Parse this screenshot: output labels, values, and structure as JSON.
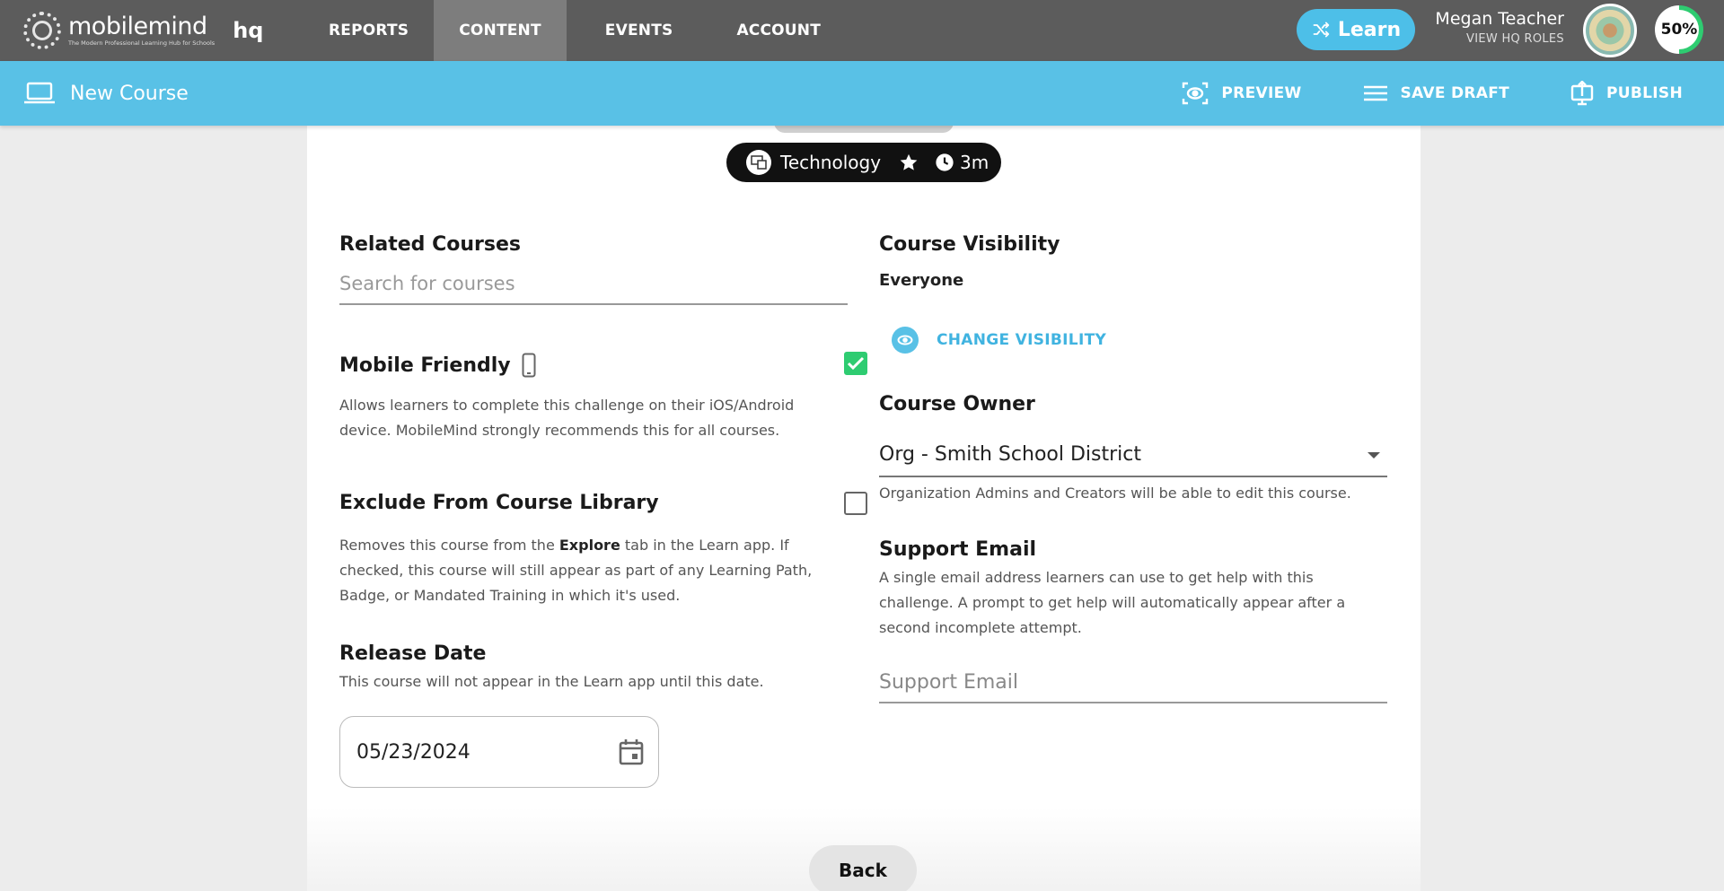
{
  "app": {
    "brand": "mobilemind",
    "tagline": "The Modern Professional Learning Hub for Schools",
    "brand_suffix": "hq"
  },
  "nav": {
    "tabs": [
      {
        "label": "REPORTS",
        "active": false
      },
      {
        "label": "CONTENT",
        "active": true
      },
      {
        "label": "EVENTS",
        "active": false
      },
      {
        "label": "ACCOUNT",
        "active": false
      }
    ],
    "learn_label": "Learn"
  },
  "user": {
    "name": "Megan Teacher",
    "roles_link": "VIEW HQ ROLES",
    "progress": "50%"
  },
  "subheader": {
    "title": "New Course",
    "actions": {
      "preview": "PREVIEW",
      "save_draft": "SAVE DRAFT",
      "publish": "PUBLISH"
    }
  },
  "course_badge": {
    "category": "Technology",
    "duration": "3m"
  },
  "related_courses": {
    "heading": "Related Courses",
    "placeholder": "Search for courses"
  },
  "mobile_friendly": {
    "heading": "Mobile Friendly",
    "checked": true,
    "desc": "Allows learners to complete this challenge on their iOS/Android device. MobileMind strongly recommends this for all courses."
  },
  "exclude_library": {
    "heading": "Exclude From Course Library",
    "checked": false,
    "desc_pre": "Removes this course from the ",
    "desc_bold": "Explore",
    "desc_post": " tab in the Learn app. If checked, this course will still appear as part of any Learning Path, Badge, or Mandated Training in which it's used."
  },
  "release_date": {
    "heading": "Release Date",
    "desc": "This course will not appear in the Learn app until this date.",
    "value": "05/23/2024"
  },
  "visibility": {
    "heading": "Course Visibility",
    "value": "Everyone",
    "change_label": "CHANGE VISIBILITY"
  },
  "owner": {
    "heading": "Course Owner",
    "value": "Org - Smith School District",
    "desc": "Organization Admins and Creators will be able to edit this course."
  },
  "support_email": {
    "heading": "Support Email",
    "desc": "A single email address learners can use to get help with this challenge. A prompt to get help will automatically appear after a second incomplete attempt.",
    "placeholder": "Support Email"
  },
  "footer": {
    "back_label": "Back"
  },
  "colors": {
    "topnav": "#5c5c5c",
    "accent": "#59c1e6",
    "check": "#2ecc71"
  }
}
